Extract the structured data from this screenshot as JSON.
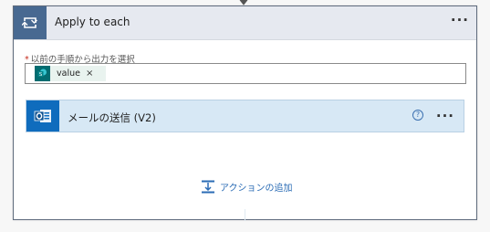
{
  "loop": {
    "title": "Apply to each",
    "more_label": "···",
    "icon": "loop-icon"
  },
  "input": {
    "label": "以前の手順から出力を選択",
    "required_marker": "*",
    "token": {
      "label": "value",
      "remove": "×",
      "icon": "sharepoint-icon"
    }
  },
  "action": {
    "title": "メールの送信 (V2)",
    "help": "?",
    "more_label": "···",
    "icon": "outlook-icon"
  },
  "add_action": {
    "label": "アクションの追加",
    "icon": "add-action-icon"
  },
  "colors": {
    "loop_accent": "#486991",
    "action_accent": "#0f6cbd",
    "action_bg": "#d7e8f5",
    "link": "#2b6cb5",
    "sharepoint": "#036c70"
  }
}
